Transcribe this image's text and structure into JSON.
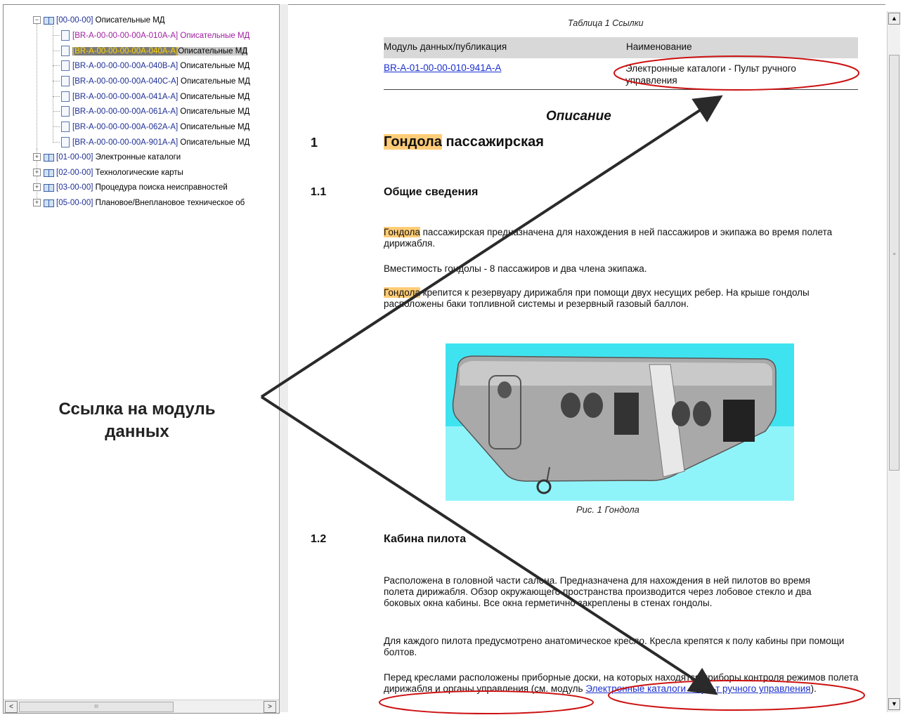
{
  "tree": {
    "root": {
      "code": "[00-00-00]",
      "title": "Описательные МД"
    },
    "children": [
      {
        "code": "[BR-A-00-00-00-00A-010A-A]",
        "title": "Описательные МД",
        "visited": true
      },
      {
        "code": "[BR-A-00-00-00-00A-040A-A]",
        "title": "Описательные МД",
        "selected": true
      },
      {
        "code": "[BR-A-00-00-00-00A-040B-A]",
        "title": "Описательные МД"
      },
      {
        "code": "[BR-A-00-00-00-00A-040C-A]",
        "title": "Описательные МД"
      },
      {
        "code": "[BR-A-00-00-00-00A-041A-A]",
        "title": "Описательные МД"
      },
      {
        "code": "[BR-A-00-00-00-00A-061A-A]",
        "title": "Описательные МД"
      },
      {
        "code": "[BR-A-00-00-00-00A-062A-A]",
        "title": "Описательные МД"
      },
      {
        "code": "[BR-A-00-00-00-00A-901A-A]",
        "title": "Описательные МД"
      }
    ],
    "groups": [
      {
        "code": "[01-00-00]",
        "title": "Электронные каталоги"
      },
      {
        "code": "[02-00-00]",
        "title": "Технологические карты"
      },
      {
        "code": "[03-00-00]",
        "title": "Процедура поиска неисправностей"
      },
      {
        "code": "[05-00-00]",
        "title": "Плановое/Внеплановое техническое об"
      }
    ],
    "expand_symbol": "−",
    "collapse_symbol": "+",
    "scroll_thumb_grip": "III",
    "scroll_left": "<",
    "scroll_right": ">"
  },
  "content": {
    "ref_table": {
      "caption": "Таблица 1   Ссылки",
      "col_module": "Модуль данных/публикация",
      "col_name": "Наименование",
      "row_link": "BR-A-01-00-00-010-941A-A",
      "row_name": "Электронные каталоги - Пульт ручного управления"
    },
    "section_title": "Описание",
    "h1_num": "1",
    "h1_highlight": "Гондола",
    "h1_rest": " пассажирская",
    "h11_num": "1.1",
    "h11_title": "Общие  сведения",
    "p1_hl": "Гондола",
    "p1_rest": " пассажирская предназначена для нахождения в ней пассажиров и экипажа во время полета дирижабля.",
    "p2": "Вместимость гондолы - 8 пассажиров и два члена экипажа.",
    "p3_hl": "Гондола",
    "p3_rest": " крепится к резервуару дирижабля при помощи двух несущих ребер. На крыше гондолы расположены баки топливной системы и резервный газовый баллон.",
    "figure_caption": "Рис.  1   Гондола",
    "h12_num": "1.2",
    "h12_title": "Кабина  пилота",
    "p4": "Расположена в головной части салона. Предназначена для нахождения в ней пилотов во время полета дирижабля. Обзор окружающего пространства производится через лобовое стекло и два боковых окна кабины. Все окна герметично закреплены в стенах гондолы.",
    "p5": "Для каждого пилота предусмотрено анатомическое кресло. Кресла крепятся к полу кабины при помощи болтов.",
    "p6_text": "Перед креслами расположены приборные доски, на которых находятся приборы контроля режимов полета дирижабля и органы управления (см. модуль ",
    "p6_link": "Электронные каталоги - Пульт ручного управления",
    "p6_end": ")."
  },
  "scrollbar": {
    "up": "▲",
    "down": "▼",
    "grip": "≡"
  },
  "callout": "Ссылка на модуль данных",
  "colors": {
    "link": "#1a2fd0",
    "highlight": "#ffcc77",
    "visited": "#a020a0",
    "annotation": "#cc1111",
    "arrow": "#2a2a2a",
    "figure_bg": "#3fe3f0"
  }
}
